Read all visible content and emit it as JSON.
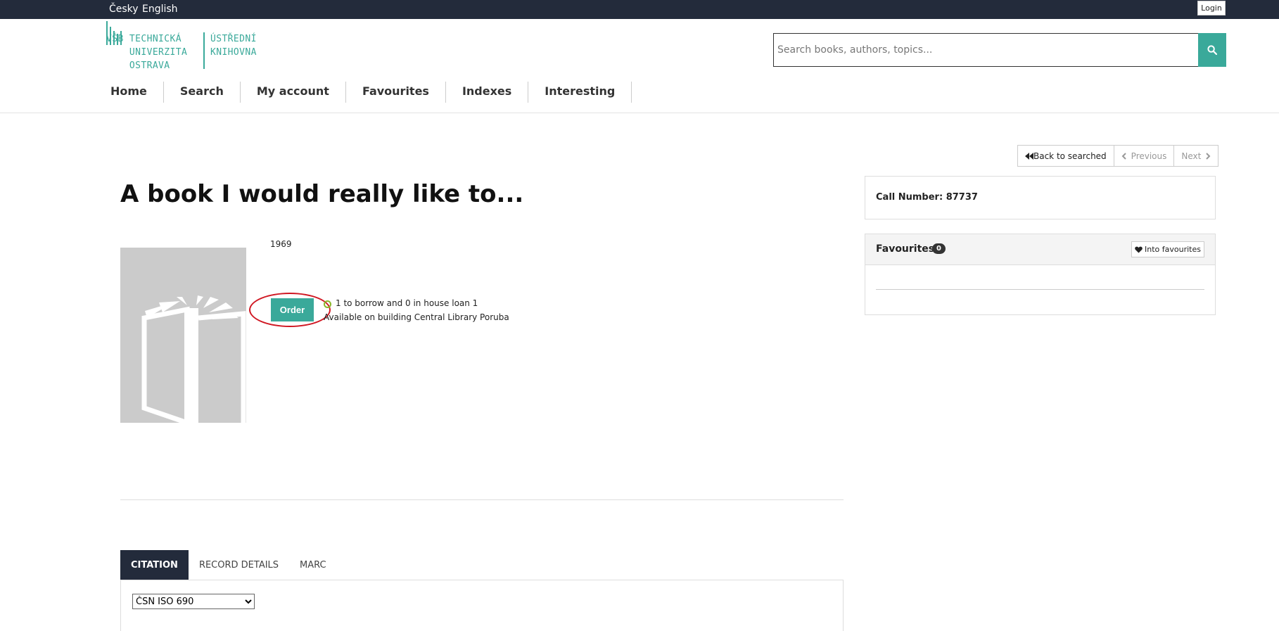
{
  "topbar": {
    "lang_cs": "Česky",
    "lang_en": "English",
    "login_label": "Login"
  },
  "logo": {
    "left_text": "VŠB TECHNICKÁ\n    UNIVERZITA\n    OSTRAVA",
    "right_text": "ÚSTŘEDNÍ\nKNIHOVNA"
  },
  "search": {
    "placeholder": "Search books, authors, topics...",
    "value": ""
  },
  "nav": {
    "items": [
      "Home",
      "Search",
      "My account",
      "Favourites",
      "Indexes",
      "Interesting"
    ]
  },
  "pager": {
    "back_label": "Back to searched",
    "previous_label": "Previous",
    "next_label": "Next"
  },
  "record": {
    "title": "A book I would really like to...",
    "year": "1969",
    "order_label": "Order",
    "availability_line1": "1 to borrow and 0 in house loan 1",
    "availability_line2": "Available on building Central Library Poruba"
  },
  "sidebar": {
    "call_number": "Call Number: 87737",
    "favourites_title": "Favourites",
    "favourites_count": "0",
    "into_favourites_label": "Into favourites"
  },
  "tabs": {
    "items": [
      "CITATION",
      "RECORD DETAILS",
      "MARC"
    ],
    "active": "CITATION",
    "citation_style": "ČSN ISO 690"
  },
  "colors": {
    "accent": "#3aa99a",
    "topbar": "#232b3b",
    "highlight": "#d01722"
  }
}
